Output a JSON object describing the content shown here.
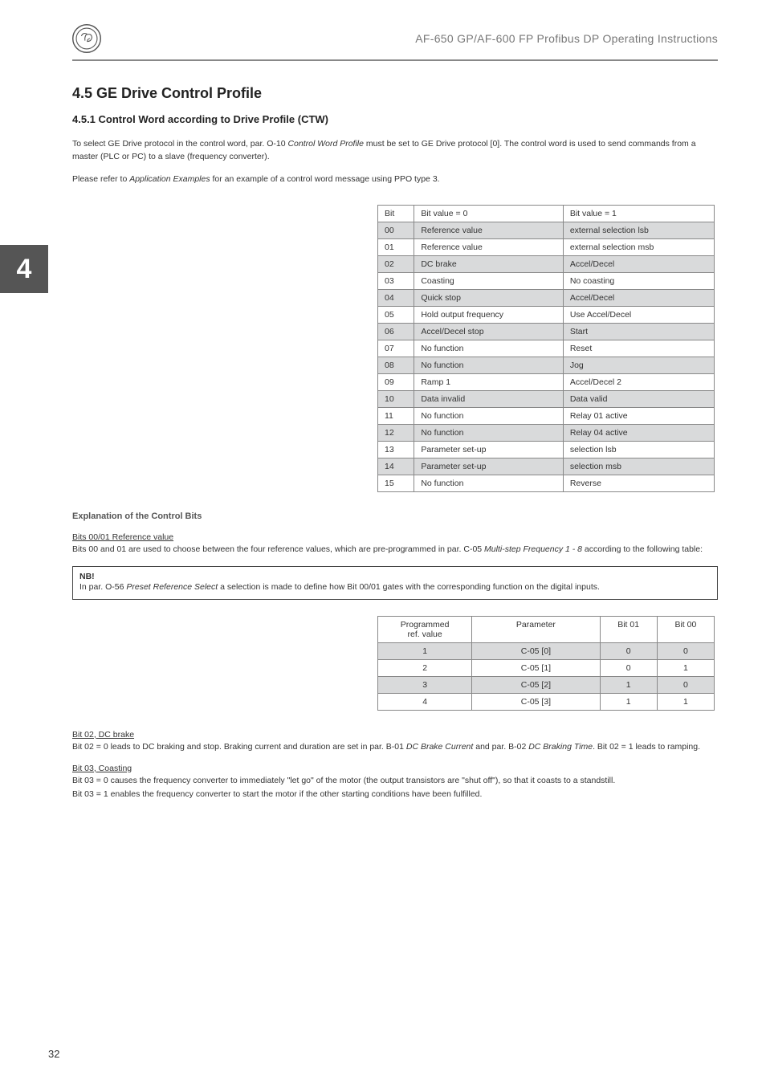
{
  "header": {
    "title": "AF-650 GP/AF-600 FP Profibus DP Operating Instructions"
  },
  "chapter_tab": "4",
  "section": {
    "number_title": "4.5  GE Drive Control Profile",
    "subsection_title": "4.5.1  Control Word according to Drive Profile (CTW)",
    "intro1a": "To select GE Drive protocol in the control word, par. O-10 ",
    "intro1b": "Control Word Profile",
    "intro1c": " must be set to GE Drive protocol [0]. The control word is used to send commands from a master (PLC or PC) to a slave (frequency converter).",
    "intro2a": "Please refer to ",
    "intro2b": "Application Examples",
    "intro2c": " for an example of a control word message using PPO type 3."
  },
  "table1": {
    "headers": [
      "Bit",
      "Bit value = 0",
      "Bit value = 1"
    ],
    "rows": [
      [
        "00",
        "Reference value",
        "external selection lsb"
      ],
      [
        "01",
        "Reference value",
        "external selection msb"
      ],
      [
        "02",
        "DC brake",
        "Accel/Decel"
      ],
      [
        "03",
        "Coasting",
        "No coasting"
      ],
      [
        "04",
        "Quick stop",
        "Accel/Decel"
      ],
      [
        "05",
        "Hold output frequency",
        "Use Accel/Decel"
      ],
      [
        "06",
        "Accel/Decel stop",
        "Start"
      ],
      [
        "07",
        "No function",
        "Reset"
      ],
      [
        "08",
        "No function",
        "Jog"
      ],
      [
        "09",
        "Ramp 1",
        "Accel/Decel 2"
      ],
      [
        "10",
        "Data invalid",
        "Data valid"
      ],
      [
        "11",
        "No function",
        "Relay 01 active"
      ],
      [
        "12",
        "No function",
        "Relay 04 active"
      ],
      [
        "13",
        "Parameter set-up",
        "selection lsb"
      ],
      [
        "14",
        "Parameter set-up",
        "selection msb"
      ],
      [
        "15",
        "No function",
        "Reverse"
      ]
    ]
  },
  "explanation_head": "Explanation of the Control Bits",
  "bits0001": {
    "head": "Bits 00/01 Reference value",
    "text_a": "Bits 00 and 01 are used to choose between the four reference values, which are pre-programmed in par. C-05 ",
    "text_b": "Multi-step Frequency 1 - 8",
    "text_c": "  according to the following table:"
  },
  "nb": {
    "label": "NB!",
    "text_a": "In par. O-56 ",
    "text_b": "Preset Reference Select",
    "text_c": " a selection is made to define how Bit 00/01 gates with the corresponding function on the digital inputs."
  },
  "table2": {
    "headers": [
      "Programmed ref. value",
      "Parameter",
      "Bit 01",
      "Bit 00"
    ],
    "h1a": "Programmed",
    "h1b": "ref. value",
    "h2": "Parameter",
    "h3": "Bit 01",
    "h4": "Bit 00",
    "rows": [
      [
        "1",
        "C-05 [0]",
        "0",
        "0"
      ],
      [
        "2",
        "C-05 [1]",
        "0",
        "1"
      ],
      [
        "3",
        "C-05 [2]",
        "1",
        "0"
      ],
      [
        "4",
        "C-05 [3]",
        "1",
        "1"
      ]
    ]
  },
  "bit02": {
    "head": "Bit 02, DC brake",
    "text_a": "Bit 02 = 0 leads to DC braking and stop. Braking current and duration are set in par. B-01 ",
    "text_b": "DC Brake Current",
    "text_c": " and par. B-02 ",
    "text_d": "DC Braking Time",
    "text_e": ". Bit 02 = 1 leads to ramping."
  },
  "bit03": {
    "head": "Bit 03, Coasting",
    "line1": "Bit 03 = 0 causes the frequency converter to immediately \"let go\" of the motor (the output transistors are \"shut off\"), so that it coasts to a standstill.",
    "line2": "Bit 03 = 1 enables the frequency converter to start the motor if the other starting conditions have been fulfilled."
  },
  "page_number": "32"
}
